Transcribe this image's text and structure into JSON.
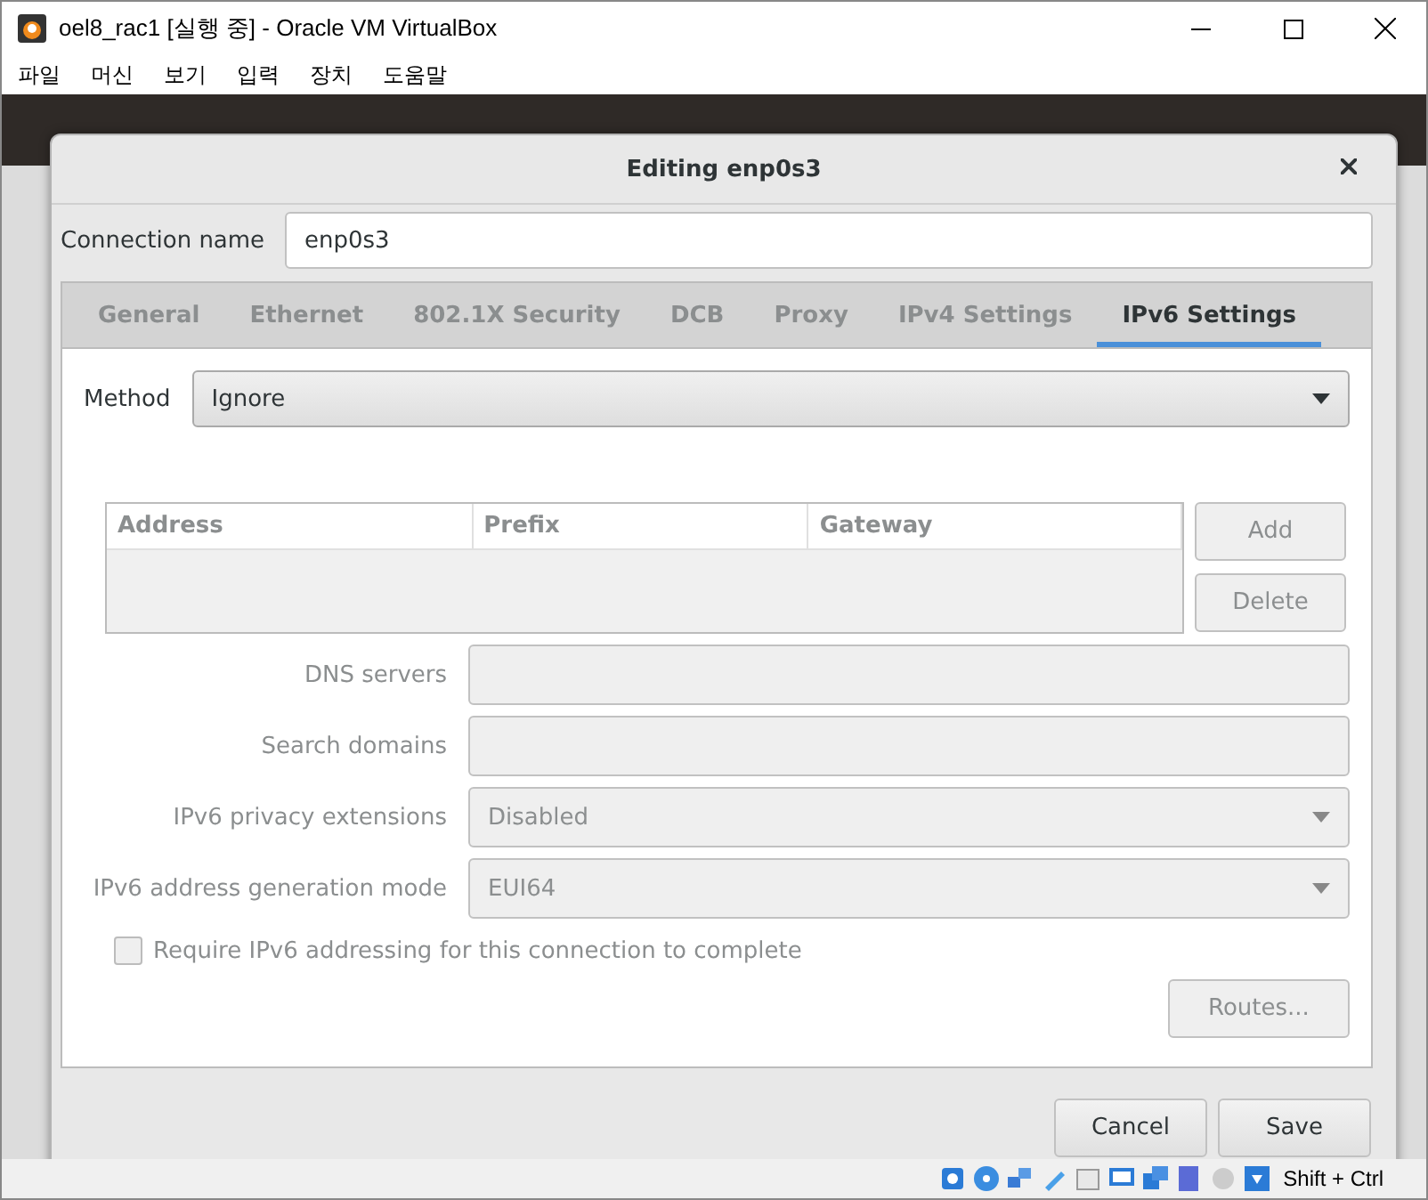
{
  "window": {
    "title": "oel8_rac1 [실행 중] - Oracle VM VirtualBox"
  },
  "menu": [
    "파일",
    "머신",
    "보기",
    "입력",
    "장치",
    "도움말"
  ],
  "dialog": {
    "title": "Editing enp0s3",
    "connection_name": {
      "label": "Connection name",
      "value": "enp0s3"
    },
    "tabs": [
      {
        "label": "General",
        "selected": false
      },
      {
        "label": "Ethernet",
        "selected": false
      },
      {
        "label": "802.1X Security",
        "selected": false
      },
      {
        "label": "DCB",
        "selected": false
      },
      {
        "label": "Proxy",
        "selected": false
      },
      {
        "label": "IPv4 Settings",
        "selected": false
      },
      {
        "label": "IPv6 Settings",
        "selected": true
      }
    ],
    "method": {
      "label": "Method",
      "value": "Ignore"
    },
    "address_table": {
      "columns": [
        "Address",
        "Prefix",
        "Gateway"
      ]
    },
    "table_buttons": [
      {
        "label": "Add",
        "disabled": true
      },
      {
        "label": "Delete",
        "disabled": true
      }
    ],
    "fields": [
      {
        "kind": "text",
        "label": "DNS servers",
        "disabled": true
      },
      {
        "kind": "text",
        "label": "Search domains",
        "disabled": true
      },
      {
        "kind": "dropdown",
        "label": "IPv6 privacy extensions",
        "value": "Disabled",
        "disabled": true
      },
      {
        "kind": "dropdown",
        "label": "IPv6 address generation mode",
        "value": "EUI64",
        "disabled": true
      }
    ],
    "require_checkbox": {
      "label": "Require IPv6 addressing for this connection to complete",
      "checked": false,
      "disabled": true
    },
    "routes_button": {
      "label": "Routes...",
      "disabled": true
    },
    "footer_buttons": [
      "Cancel",
      "Save"
    ]
  },
  "status_bar": {
    "host_key": "Shift + Ctrl"
  }
}
